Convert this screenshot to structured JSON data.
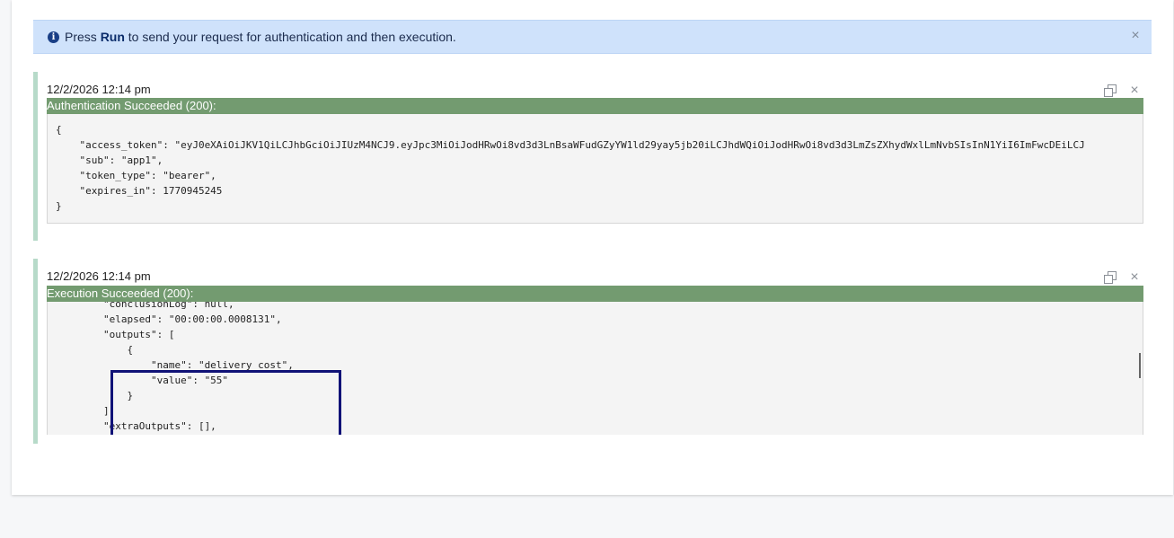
{
  "banner": {
    "prefix": "Press",
    "run_label": "Run",
    "suffix": "to send your request for authentication and then execution.",
    "close_glyph": "×",
    "info_glyph": "i"
  },
  "auth": {
    "timestamp": "12/2/2026 12:14 pm",
    "status": "Authentication Succeeded (200):",
    "close_glyph": "×",
    "lines": [
      "{",
      "    \"access_token\": \"eyJ0eXAiOiJKV1QiLCJhbGciOiJIUzM4NCJ9.eyJpc3MiOiJodHRwOi8vd3d3LnBsaWFudGZyYW1ld29yay5jb20iLCJhdWQiOiJodHRwOi8vd3d3LmZsZXhydWxlLmNvbSIsInN1YiI6ImFwcDEiLCJ",
      "    \"sub\": \"app1\",",
      "    \"token_type\": \"bearer\",",
      "    \"expires_in\": 1770945245",
      "}"
    ]
  },
  "exec": {
    "timestamp": "12/2/2026 12:14 pm",
    "status": "Execution Succeeded (200):",
    "close_glyph": "×",
    "lines": [
      "        \"conclusionLog\": null,",
      "        \"elapsed\": \"00:00:00.0008131\",",
      "        \"outputs\": [",
      "            {",
      "                \"name\": \"delivery cost\",",
      "                \"value\": \"55\"",
      "            }",
      "        ],",
      "        \"extraOutputs\": [],"
    ]
  },
  "colors": {
    "banner_bg": "#cfe2fb",
    "status_bar": "#739b70",
    "result_accent": "#b7dac9",
    "highlight_border": "#101277"
  }
}
